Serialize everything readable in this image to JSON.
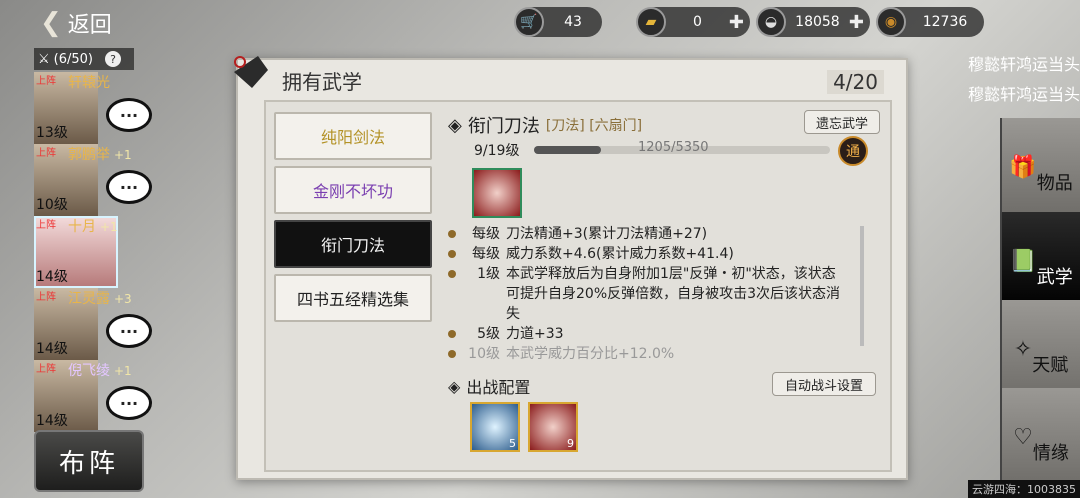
{
  "back_label": "返回",
  "currencies": [
    {
      "icon": "cart-icon",
      "value": "43",
      "plus": false
    },
    {
      "icon": "gold-ingot-icon",
      "value": "0",
      "plus": true
    },
    {
      "icon": "silver-ingot-icon",
      "value": "18058",
      "plus": true
    },
    {
      "icon": "copper-coin-icon",
      "value": "12736",
      "plus": false
    }
  ],
  "roster": {
    "count": "(6/50)",
    "heroes": [
      {
        "tag": "上阵",
        "name": "轩辕光",
        "bonus": "",
        "level": "13级"
      },
      {
        "tag": "上阵",
        "name": "郭鹏举",
        "bonus": "+1",
        "level": "10级"
      },
      {
        "tag": "上阵",
        "name": "十月",
        "bonus": "+1",
        "level": "14级"
      },
      {
        "tag": "上阵",
        "name": "江灵露",
        "bonus": "+3",
        "level": "14级"
      },
      {
        "tag": "上阵",
        "name": "倪飞绫",
        "bonus": "+1",
        "level": "14级"
      }
    ],
    "formation_label": "布阵"
  },
  "panel": {
    "title": "拥有武学",
    "count": "4/20",
    "skills": [
      "纯阳剑法",
      "金刚不坏功",
      "衔门刀法",
      "四书五经精选集"
    ],
    "detail": {
      "name": "衔门刀法",
      "tags": "[刀法] [六扇门]",
      "forget_label": "遗忘武学",
      "level": "9/19级",
      "exp": "1205/5350",
      "exp_fraction": 0.225,
      "tong": "通",
      "effects": [
        {
          "k": "每级",
          "v": "刀法精通+3(累计刀法精通+27)",
          "dim": false
        },
        {
          "k": "每级",
          "v": "威力系数+4.6(累计威力系数+41.4)",
          "dim": false
        },
        {
          "k": "1级",
          "v": "本武学释放后为自身附加1层\"反弹・初\"状态，该状态可提升自身20%反弹倍数，自身被攻击3次后该状态消失",
          "dim": false
        },
        {
          "k": "5级",
          "v": "力道+33",
          "dim": false
        },
        {
          "k": "10级",
          "v": "本武学威力百分比+12.0%",
          "dim": true
        }
      ],
      "config_title": "出战配置",
      "auto_label": "自动战斗设置",
      "slots": [
        {
          "count": "5"
        },
        {
          "count": "9"
        }
      ]
    }
  },
  "side": {
    "scroll_lines": [
      "穆懿轩鸿运当头",
      "穆懿轩鸿运当头"
    ],
    "nav": [
      {
        "label": "物品",
        "icon": "chest-icon",
        "selected": false
      },
      {
        "label": "武学",
        "icon": "book-icon",
        "selected": true
      },
      {
        "label": "天赋",
        "icon": "talent-icon",
        "selected": false
      },
      {
        "label": "情缘",
        "icon": "heart-icon",
        "selected": false
      }
    ]
  },
  "watermark": "云游四海：1003835"
}
